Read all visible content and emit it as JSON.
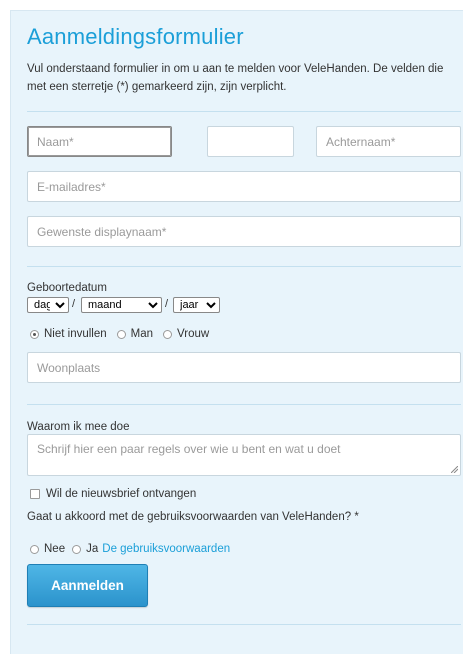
{
  "form": {
    "title": "Aanmeldingsformulier",
    "intro": "Vul onderstaand formulier in om u aan te melden voor VeleHanden. De velden die met een sterretje (*) gemarkeerd zijn, zijn verplicht.",
    "first_name_placeholder": "Naam*",
    "middle_name_value": "",
    "last_name_placeholder": "Achternaam*",
    "email_placeholder": "E-mailadres*",
    "displayname_placeholder": "Gewenste displaynaam*",
    "birthdate_label": "Geboortedatum",
    "day_select": "dag",
    "month_select": "maand",
    "year_select": "jaar",
    "date_separator": "/",
    "gender_options": [
      "Niet invullen",
      "Man",
      "Vrouw"
    ],
    "gender_selected": "Niet invullen",
    "city_placeholder": "Woonplaats",
    "why_label": "Waarom ik mee doe",
    "why_placeholder": "Schrijf hier een paar regels over wie u bent en wat u doet",
    "newsletter_label": "Wil de nieuwsbrief ontvangen",
    "terms_question": "Gaat u akkoord met de gebruiksvoorwaarden van VeleHanden? *",
    "terms_options": [
      "Nee",
      "Ja"
    ],
    "terms_link": "De gebruiksvoorwaarden",
    "submit_label": "Aanmelden"
  },
  "colors": {
    "accent": "#1b9fd8",
    "panel_bg": "#e8f4fb",
    "button_top": "#4fb6e6",
    "button_bottom": "#2b93cc"
  }
}
